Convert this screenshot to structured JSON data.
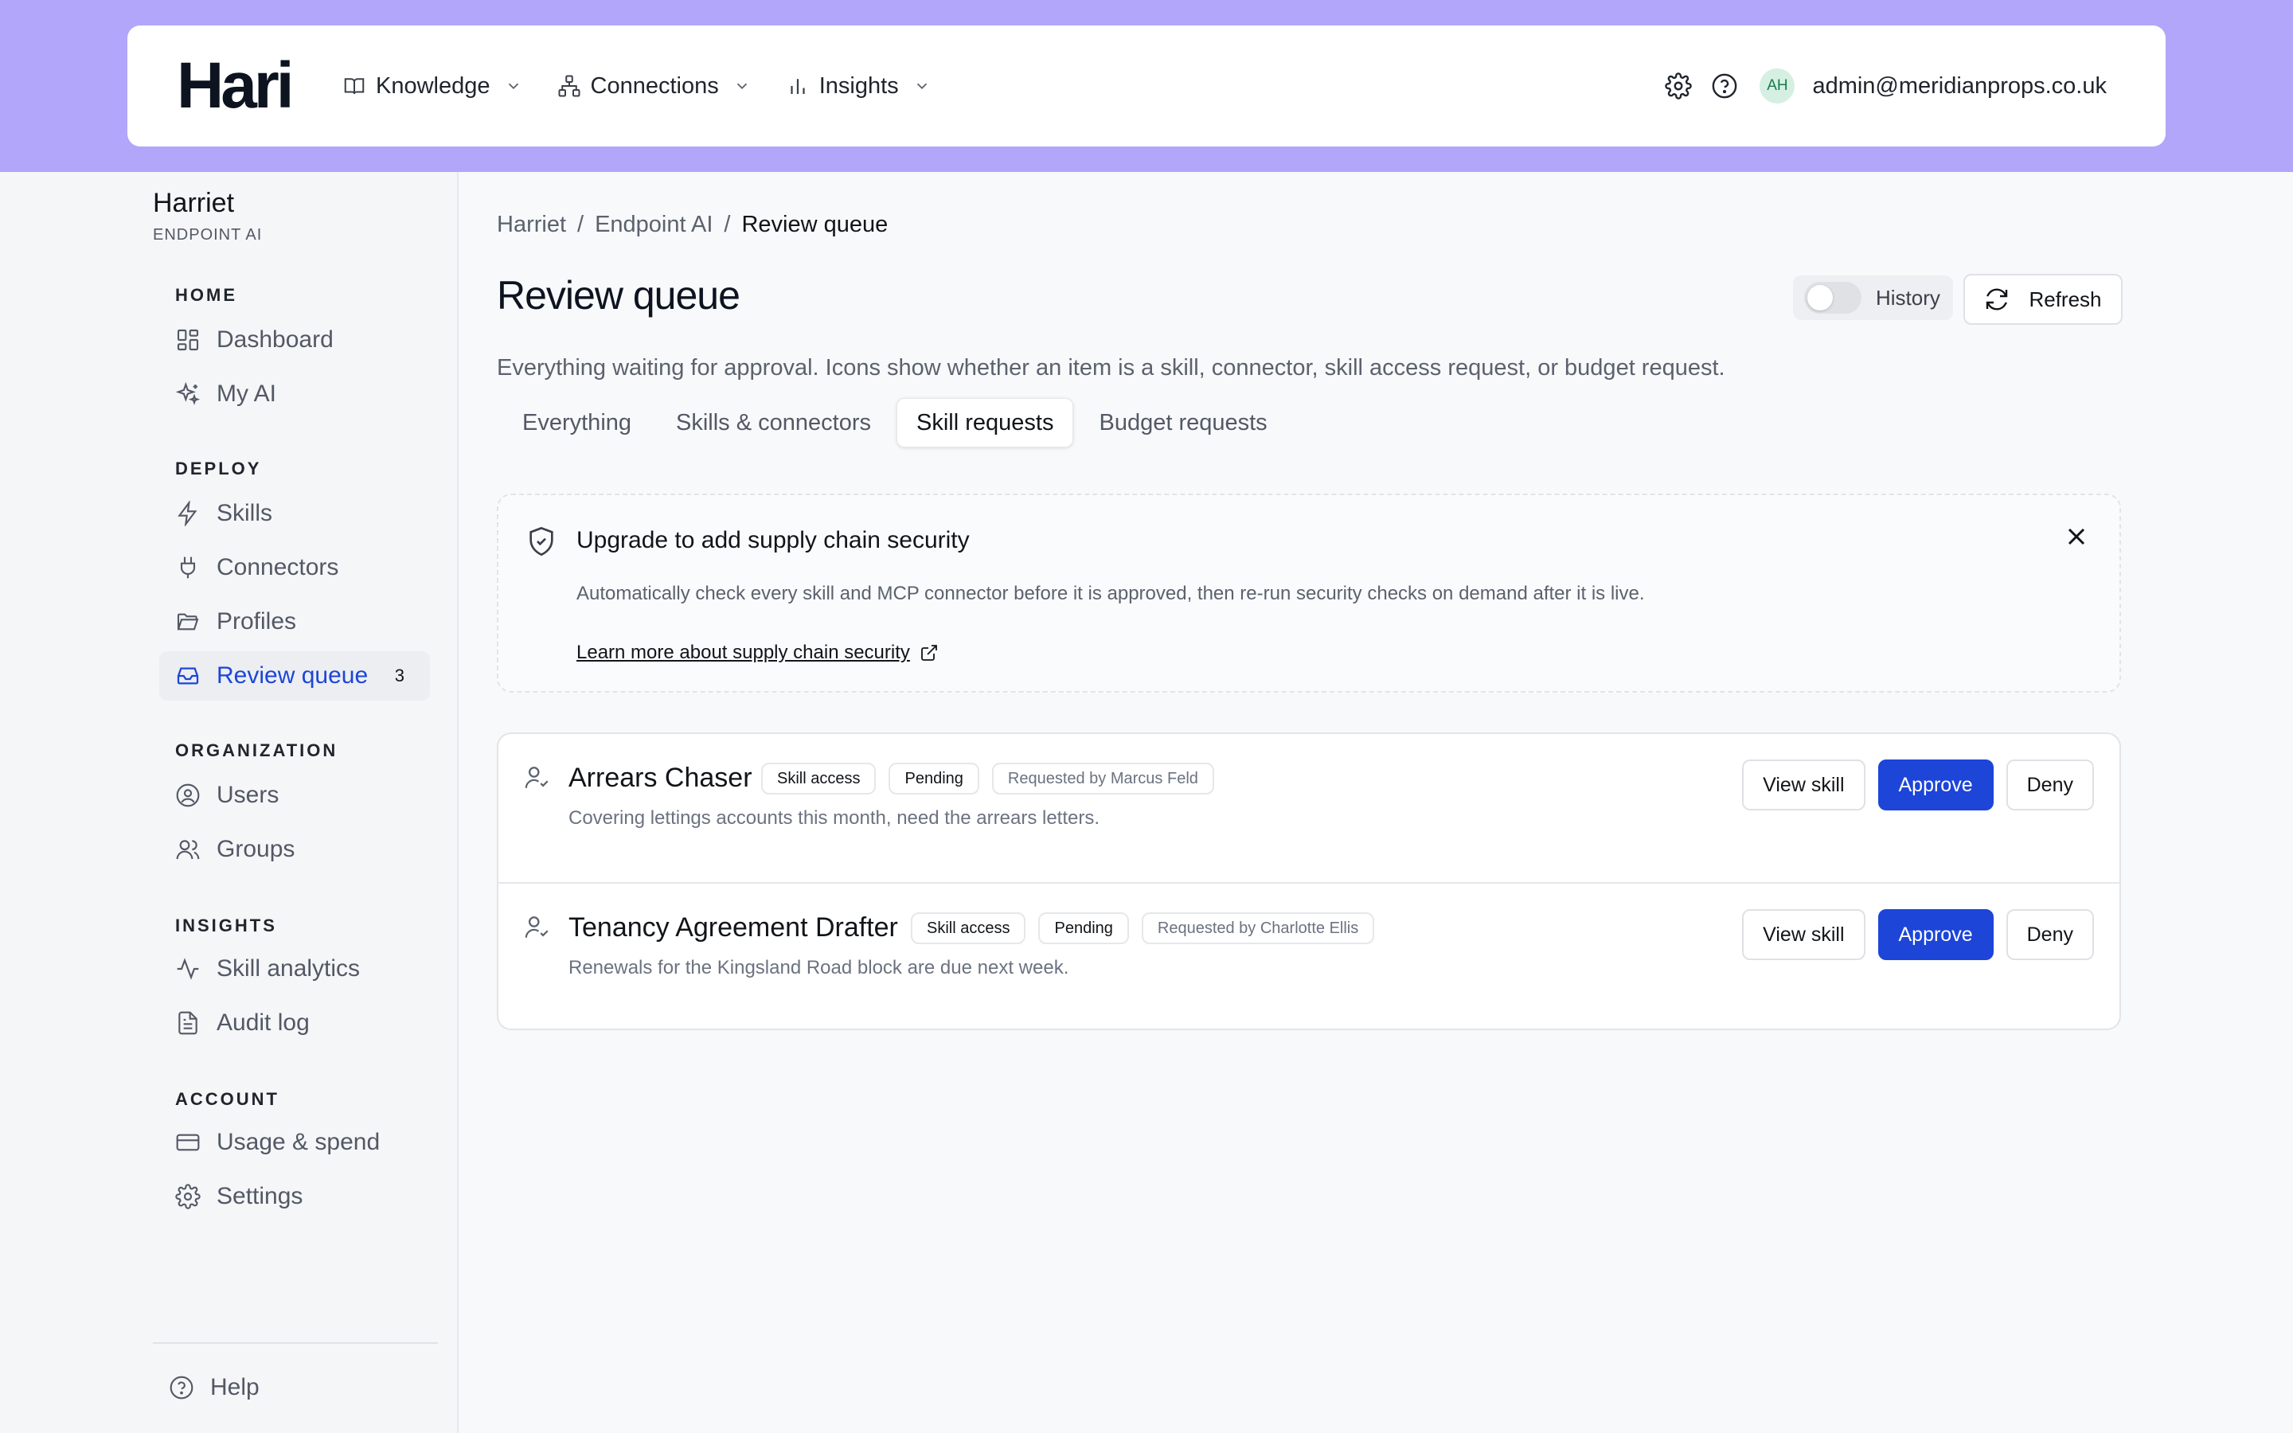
{
  "header": {
    "logo": "Hari",
    "nav": [
      {
        "label": "Knowledge"
      },
      {
        "label": "Connections"
      },
      {
        "label": "Insights"
      }
    ],
    "avatar_initials": "AH",
    "email": "admin@meridianprops.co.uk"
  },
  "sidebar": {
    "org_name": "Harriet",
    "org_sub": "ENDPOINT AI",
    "sections": {
      "home": "HOME",
      "deploy": "DEPLOY",
      "organization": "ORGANIZATION",
      "insights": "INSIGHTS",
      "account": "ACCOUNT"
    },
    "items": {
      "dashboard": "Dashboard",
      "my_ai": "My AI",
      "skills": "Skills",
      "connectors": "Connectors",
      "profiles": "Profiles",
      "review_queue": "Review queue",
      "review_queue_count": "3",
      "users": "Users",
      "groups": "Groups",
      "skill_analytics": "Skill analytics",
      "audit_log": "Audit log",
      "usage_spend": "Usage & spend",
      "settings": "Settings",
      "help": "Help"
    }
  },
  "main": {
    "breadcrumb": [
      "Harriet",
      "Endpoint AI",
      "Review queue"
    ],
    "breadcrumb_sep": "/",
    "title": "Review queue",
    "history_label": "History",
    "refresh_label": "Refresh",
    "description": "Everything waiting for approval. Icons show whether an item is a skill, connector, skill access request, or budget request.",
    "tabs": [
      "Everything",
      "Skills & connectors",
      "Skill requests",
      "Budget requests"
    ],
    "active_tab": "Skill requests",
    "banner": {
      "title": "Upgrade to add supply chain security",
      "text": "Automatically check every skill and MCP connector before it is approved, then re-run security checks on demand after it is live.",
      "link": "Learn more about supply chain security"
    },
    "requests": [
      {
        "title": "Arrears Chaser",
        "type": "Skill access",
        "status": "Pending",
        "requested_by": "Requested by Marcus Feld",
        "note": "Covering lettings accounts this month, need the arrears letters.",
        "view_label": "View skill",
        "approve_label": "Approve",
        "deny_label": "Deny"
      },
      {
        "title": "Tenancy Agreement Drafter",
        "type": "Skill access",
        "status": "Pending",
        "requested_by": "Requested by Charlotte Ellis",
        "note": "Renewals for the Kingsland Road block are due next week.",
        "view_label": "View skill",
        "approve_label": "Approve",
        "deny_label": "Deny"
      }
    ]
  },
  "colors": {
    "top_band": "#b1a6fa",
    "primary": "#1d45d8",
    "active_nav_text": "#1d45d8"
  }
}
